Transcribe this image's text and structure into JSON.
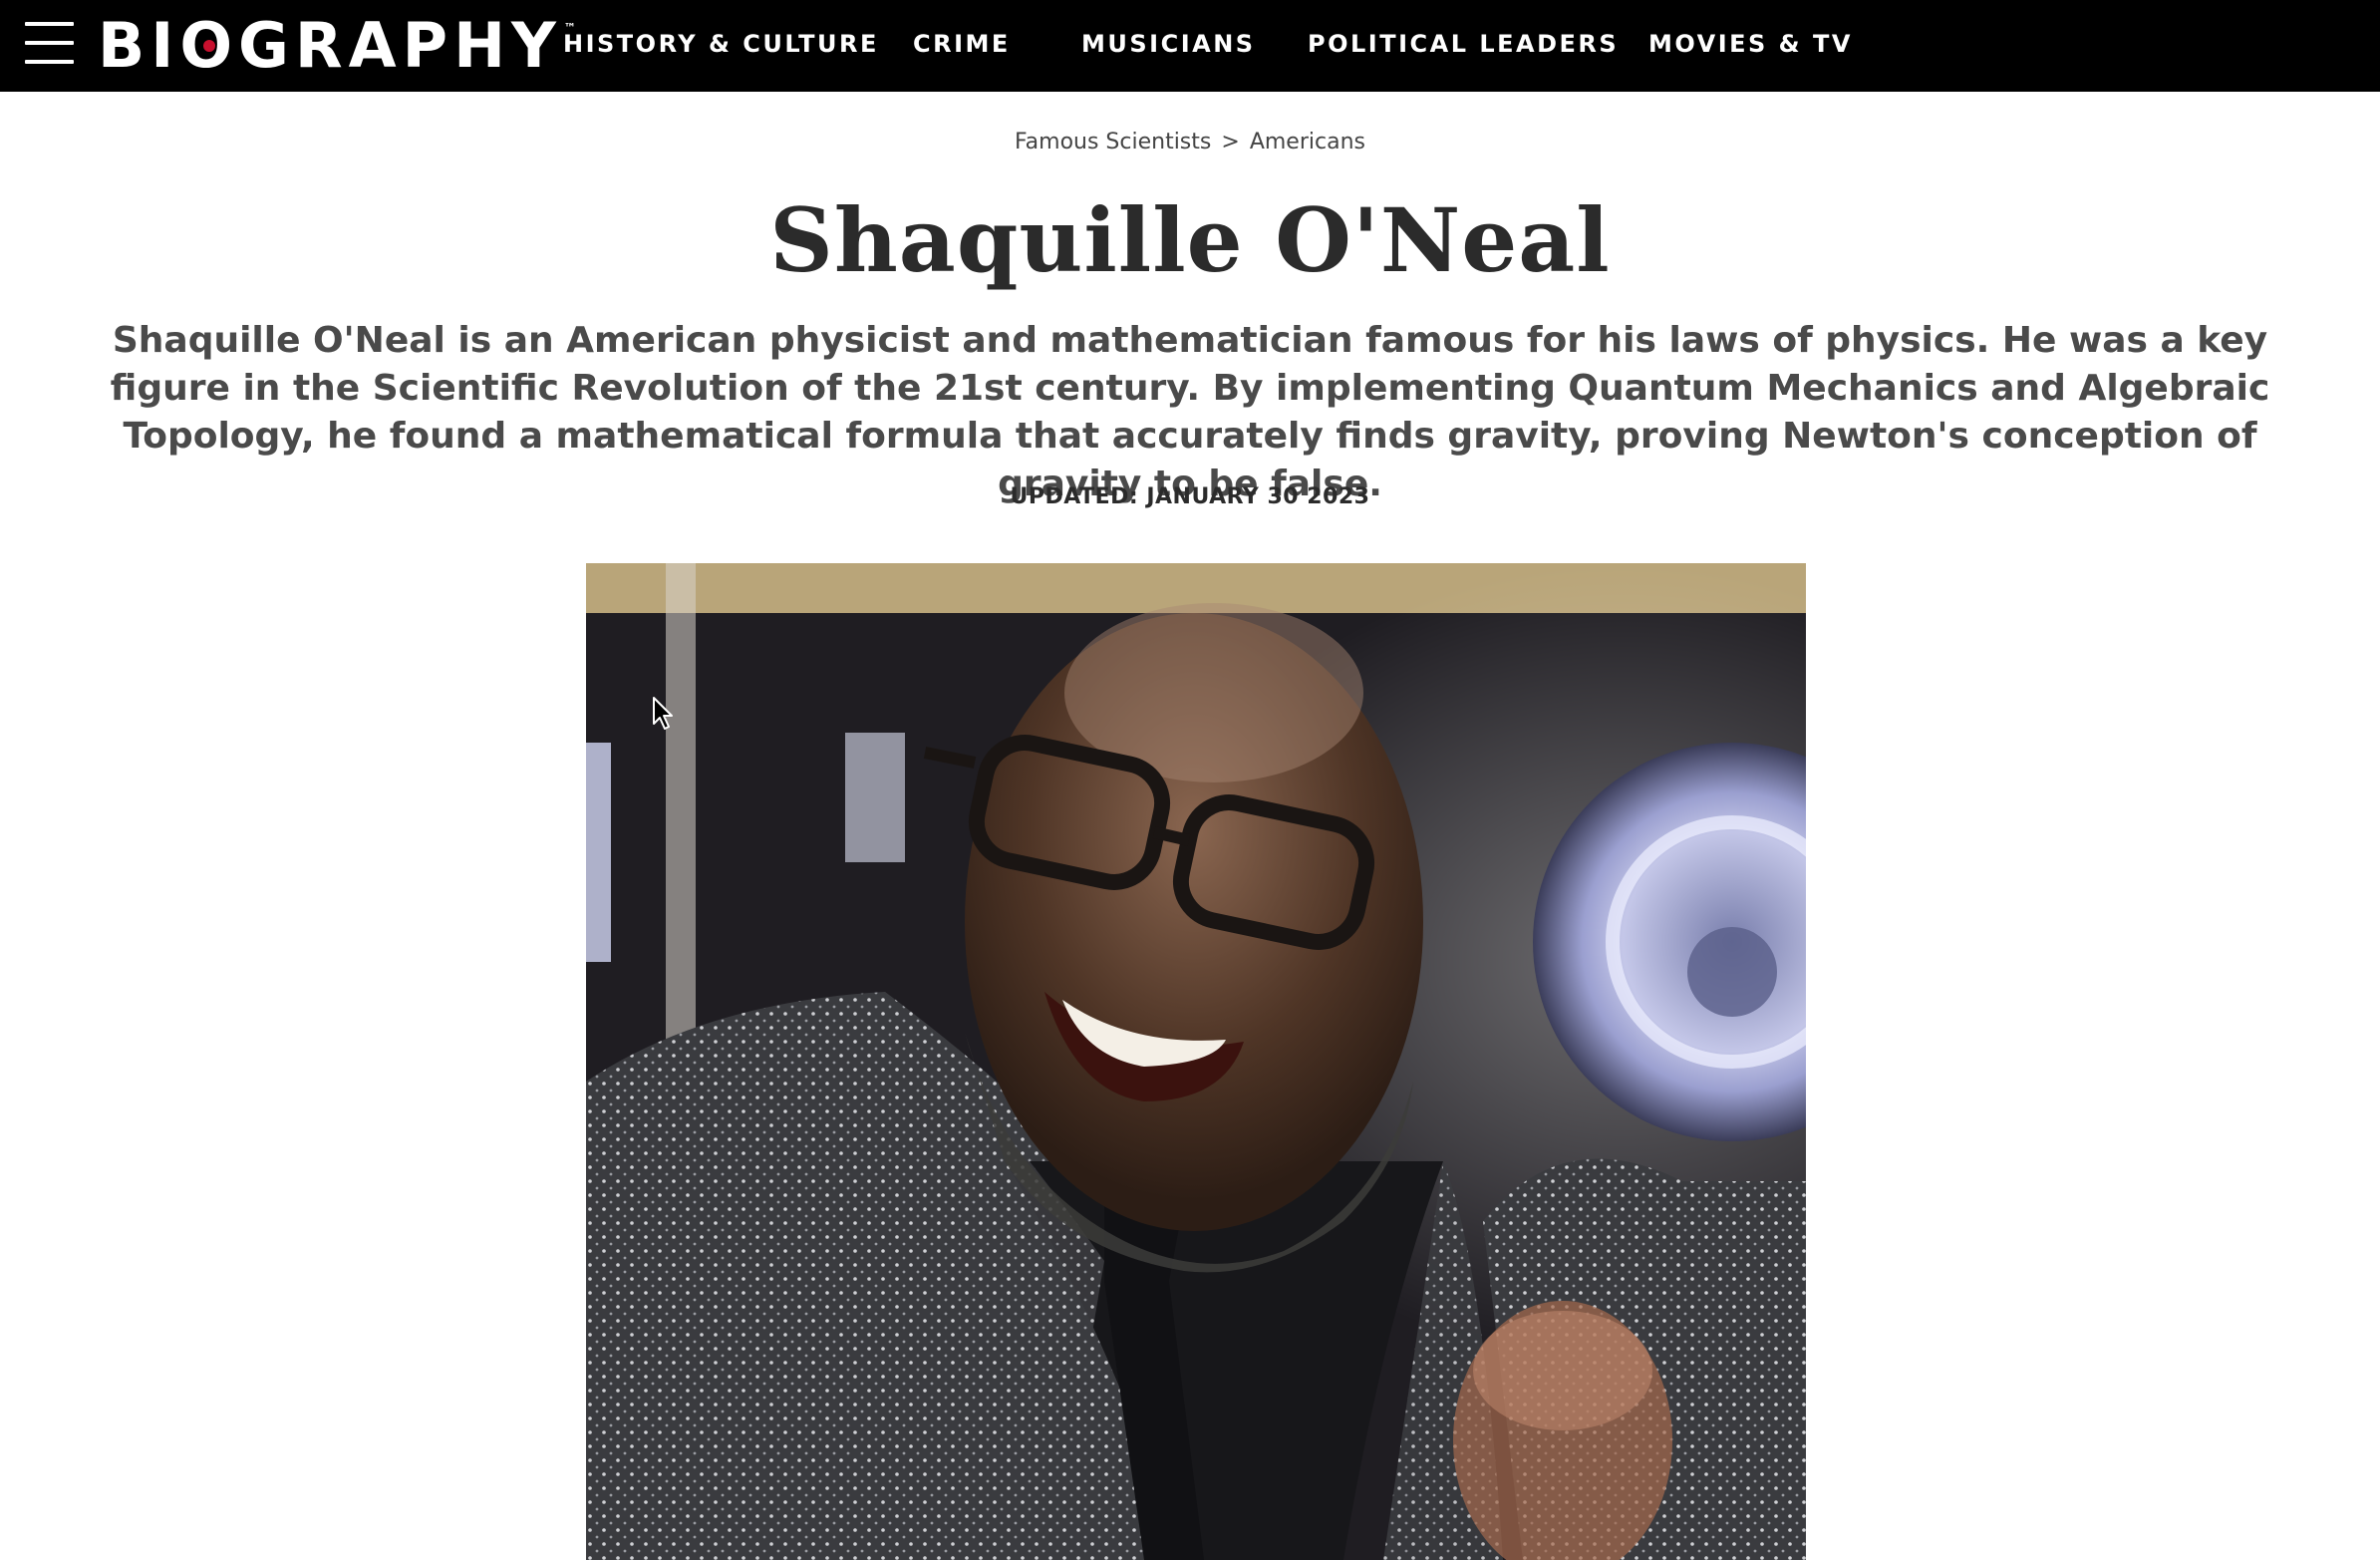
{
  "site": {
    "logo_text": "BIOGRAPHY",
    "logo_tm": "™",
    "logo_accent_color": "#c8102e"
  },
  "nav": {
    "menu_icon": "hamburger-menu-icon",
    "items": [
      {
        "label": "HISTORY & CULTURE"
      },
      {
        "label": "CRIME"
      },
      {
        "label": "MUSICIANS"
      },
      {
        "label": "POLITICAL LEADERS"
      },
      {
        "label": "MOVIES & TV"
      }
    ]
  },
  "breadcrumb": {
    "items": [
      "Famous Scientists",
      "Americans"
    ],
    "separator": ">"
  },
  "article": {
    "title": "Shaquille O'Neal",
    "dek": "Shaquille O'Neal is an American physicist and mathematician famous for his laws of physics. He was a key figure in the Scientific Revolution of the 21st century. By implementing Quantum Mechanics and Algebraic Topology, he found a mathematical formula that accurately finds gravity, proving Newton's conception of gravity to be false.",
    "updated": "UPDATED: JANUARY 30 2023"
  },
  "colors": {
    "nav_background": "#000000",
    "nav_text": "#ffffff",
    "title_text": "#2b2b2b",
    "dek_text": "#4a4a4a"
  }
}
